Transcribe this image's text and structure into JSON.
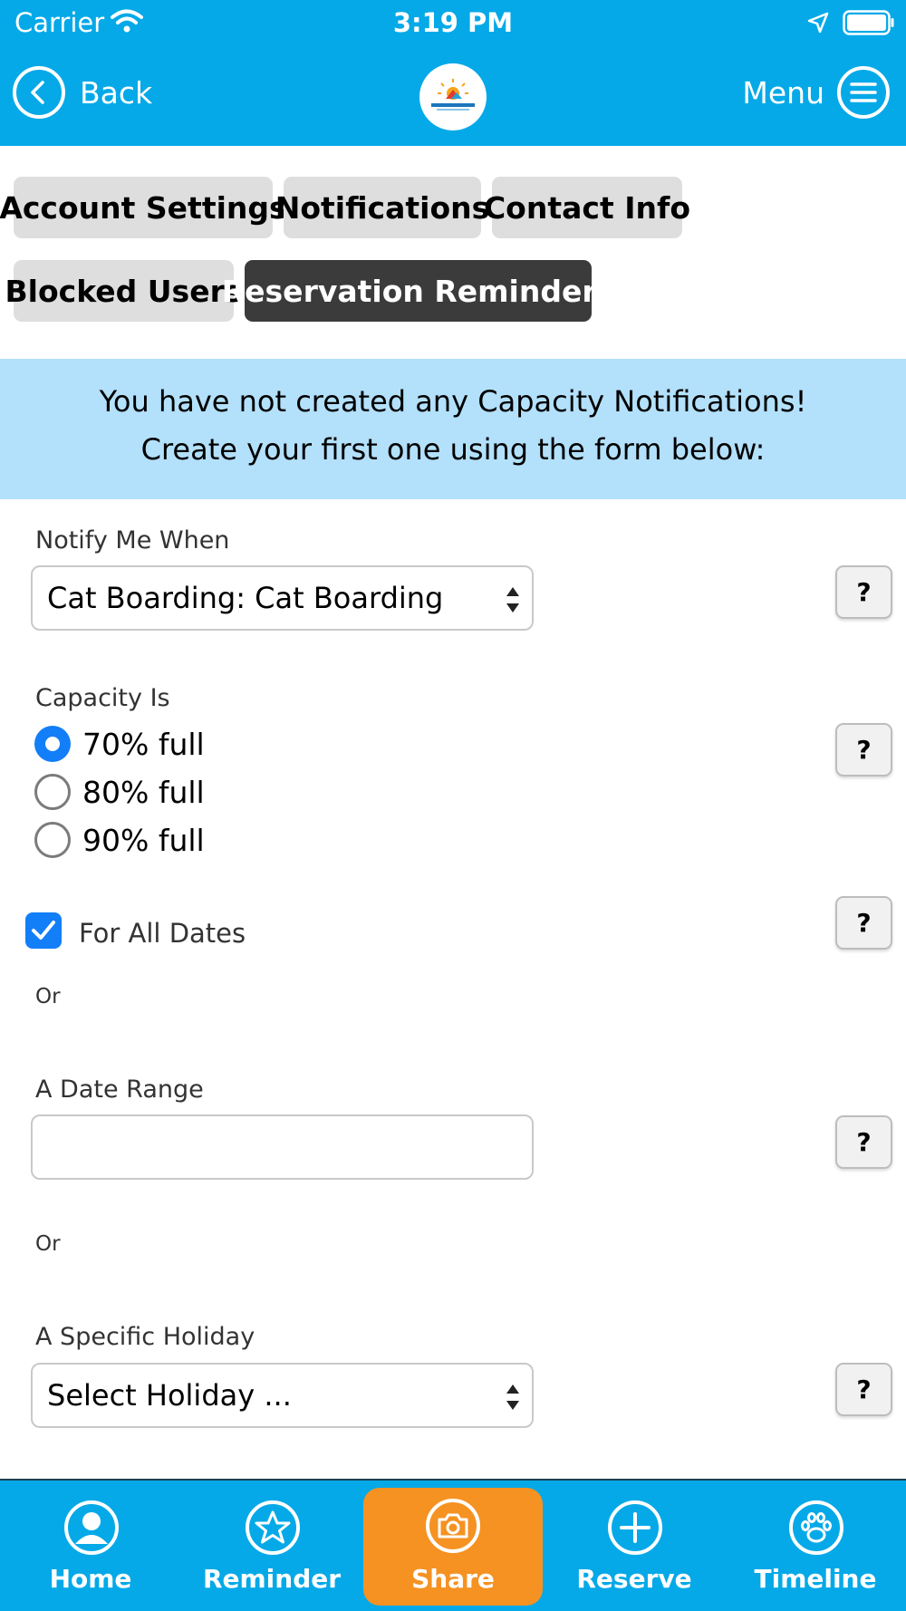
{
  "status_bar": {
    "carrier": "Carrier",
    "time": "3:19 PM"
  },
  "header": {
    "back_label": "Back",
    "menu_label": "Menu",
    "logo_icon": "navarre-beach-logo"
  },
  "tabs": [
    {
      "label": "Account Settings",
      "active": false
    },
    {
      "label": "Notifications",
      "active": false
    },
    {
      "label": "Contact Info",
      "active": false
    },
    {
      "label": "Blocked Users",
      "active": false
    },
    {
      "label": "Reservation Reminders",
      "active": true
    }
  ],
  "banner": {
    "line1": "You have not created any Capacity Notifications!",
    "line2": "Create your first one using the form below:"
  },
  "form": {
    "notify_label": "Notify Me When",
    "notify_value": "Cat Boarding: Cat Boarding",
    "capacity_label": "Capacity Is",
    "capacity_options": [
      {
        "label": "70% full",
        "selected": true
      },
      {
        "label": "80% full",
        "selected": false
      },
      {
        "label": "90% full",
        "selected": false
      }
    ],
    "all_dates_label": "For All Dates",
    "all_dates_checked": true,
    "or_text": "Or",
    "date_range_label": "A Date Range",
    "date_range_value": "",
    "holiday_label": "A Specific Holiday",
    "holiday_value": "Select Holiday ...",
    "help_text": "?"
  },
  "bottom_nav": [
    {
      "label": "Home",
      "icon": "person-icon"
    },
    {
      "label": "Reminder",
      "icon": "star-icon"
    },
    {
      "label": "Share",
      "icon": "camera-icon"
    },
    {
      "label": "Reserve",
      "icon": "plus-icon"
    },
    {
      "label": "Timeline",
      "icon": "paw-icon"
    }
  ],
  "colors": {
    "header_blue": "#05a9e8",
    "banner_blue": "#b3e0fa",
    "active_tab": "#3b3b3b",
    "share_orange": "#f59222",
    "control_blue": "#127ef8"
  }
}
